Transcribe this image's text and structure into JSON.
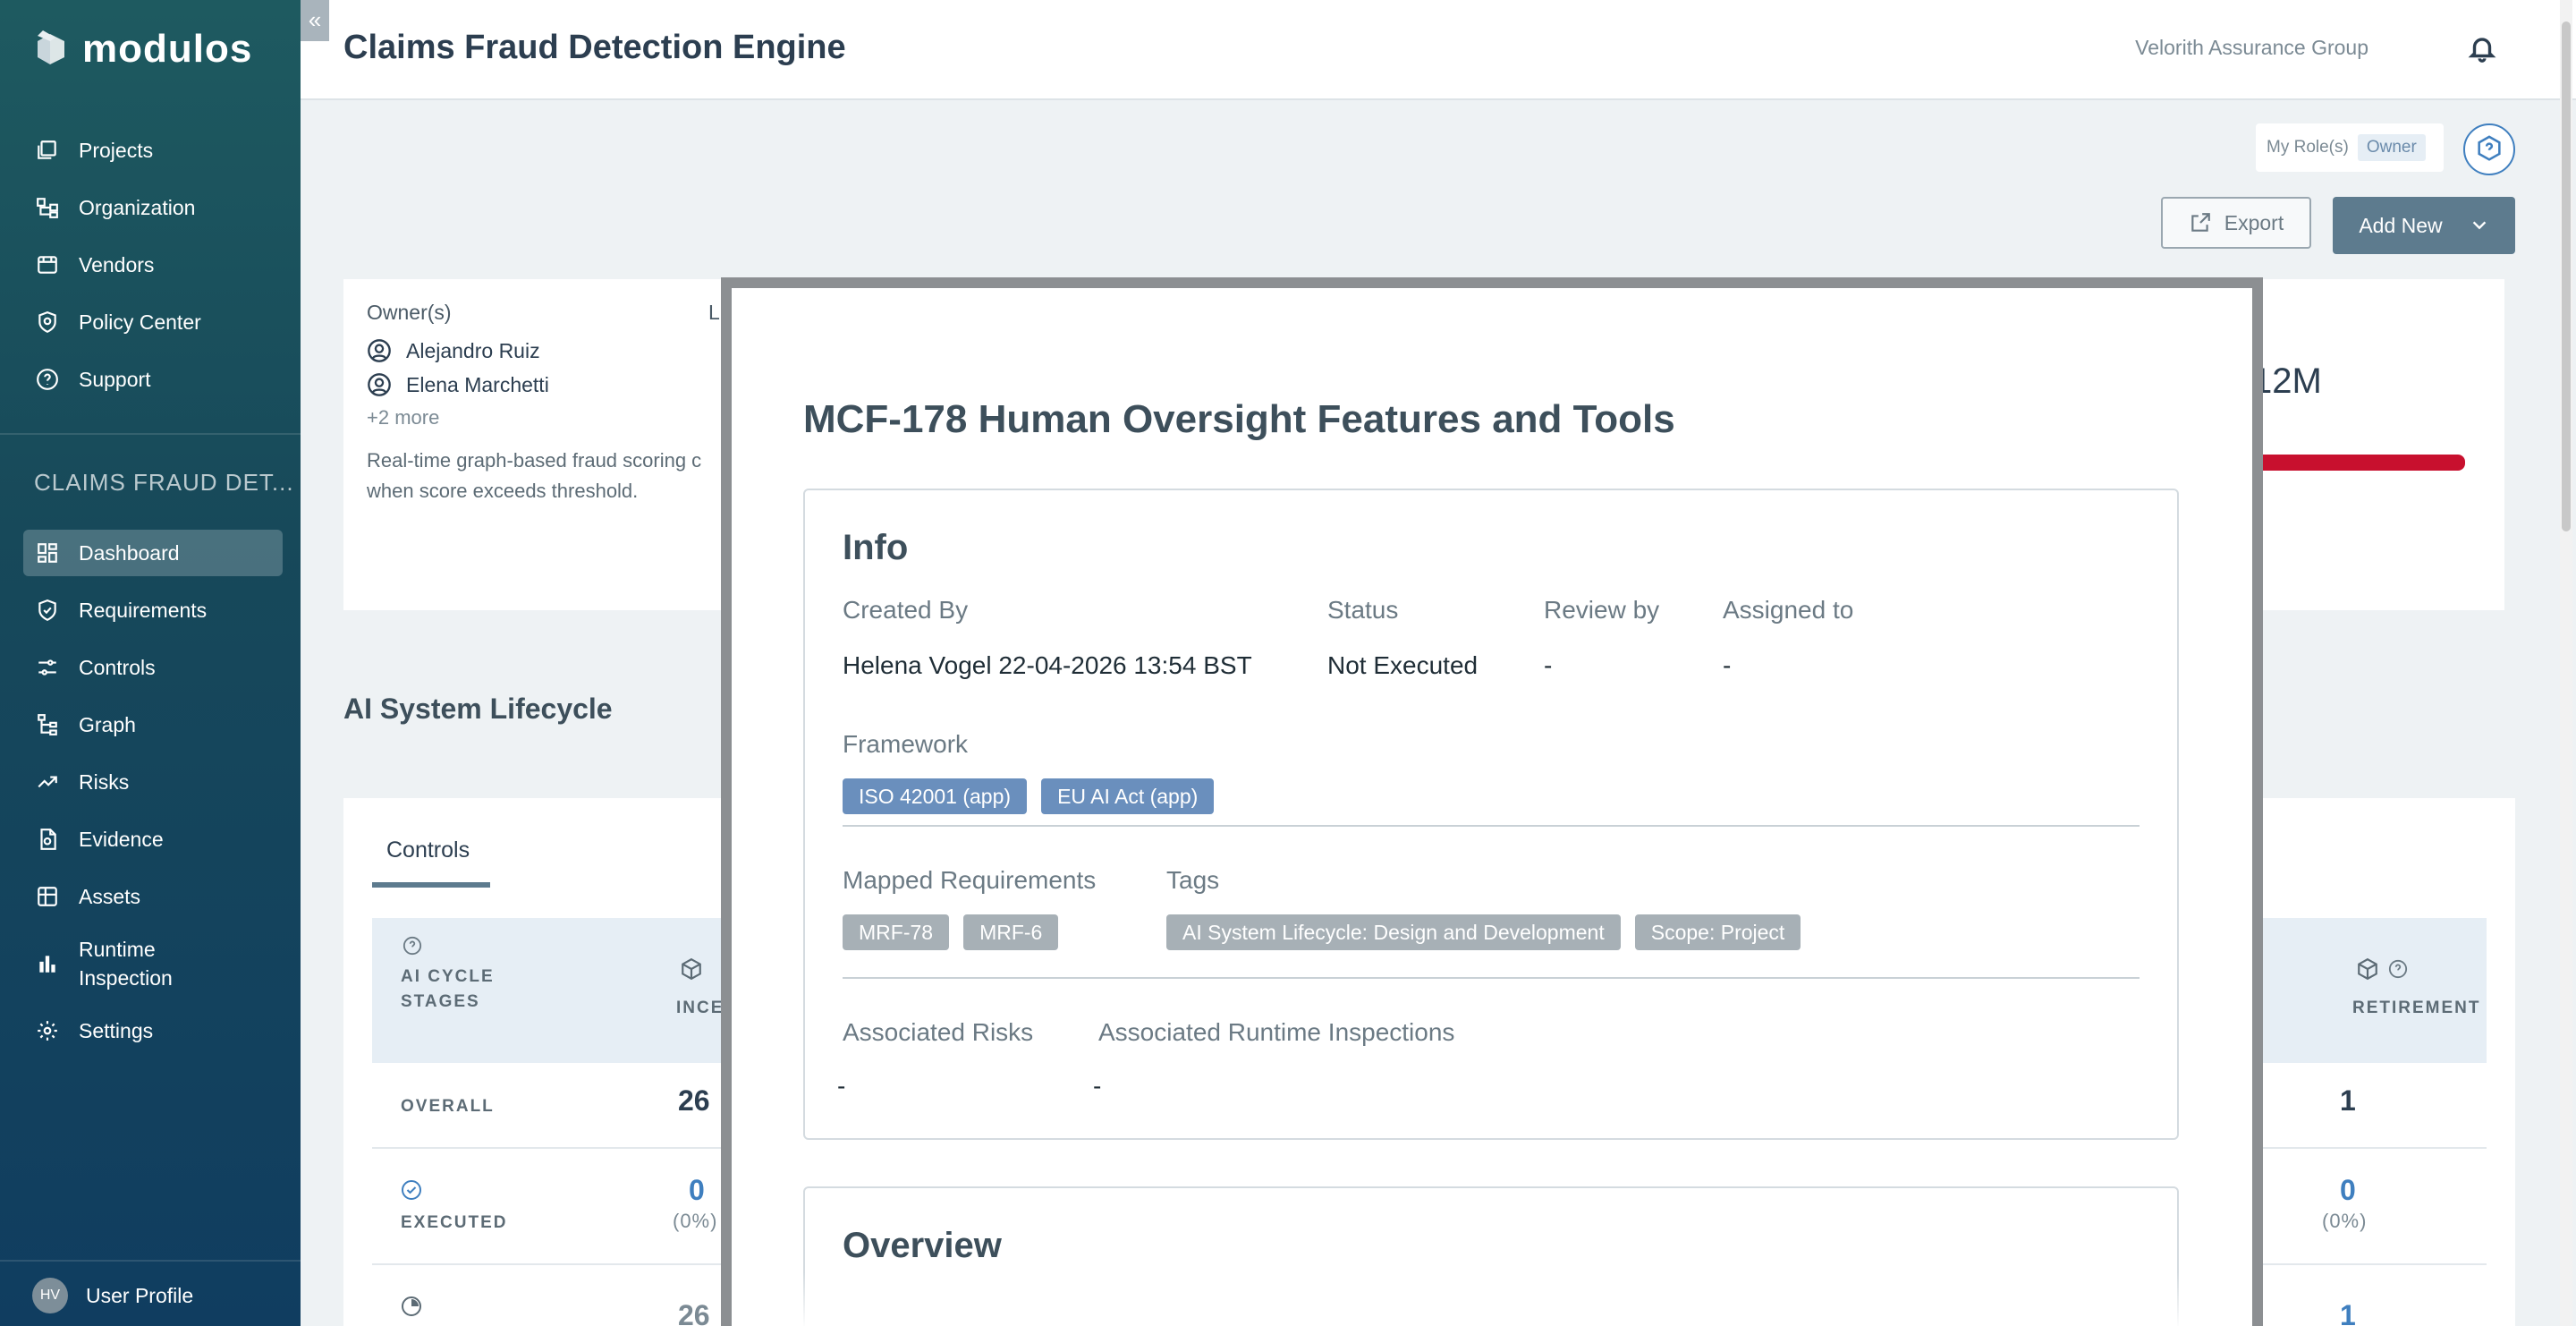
{
  "sidebar": {
    "logo": "modulos",
    "collapse_glyph": "«",
    "main_nav": [
      {
        "label": "Projects",
        "icon": "projects-icon"
      },
      {
        "label": "Organization",
        "icon": "organization-icon"
      },
      {
        "label": "Vendors",
        "icon": "vendors-icon"
      },
      {
        "label": "Policy Center",
        "icon": "policy-center-icon"
      },
      {
        "label": "Support",
        "icon": "support-icon"
      }
    ],
    "project_heading": "CLAIMS FRAUD DET...",
    "project_nav": [
      {
        "label": "Dashboard",
        "icon": "dashboard-icon",
        "active": true
      },
      {
        "label": "Requirements",
        "icon": "requirements-icon"
      },
      {
        "label": "Controls",
        "icon": "controls-icon"
      },
      {
        "label": "Graph",
        "icon": "graph-icon"
      },
      {
        "label": "Risks",
        "icon": "risks-icon"
      },
      {
        "label": "Evidence",
        "icon": "evidence-icon"
      },
      {
        "label": "Assets",
        "icon": "assets-icon"
      },
      {
        "label": "Runtime Inspection",
        "icon": "runtime-inspection-icon"
      },
      {
        "label": "Settings",
        "icon": "settings-icon"
      }
    ],
    "user": {
      "initials": "HV",
      "label": "User Profile"
    }
  },
  "header": {
    "title": "Claims Fraud Detection Engine",
    "org": "Velorith Assurance Group"
  },
  "toolbar": {
    "role_label": "My Role(s)",
    "role_value": "Owner",
    "export_label": "Export",
    "add_new_label": "Add New"
  },
  "owner_card": {
    "owners_label": "Owner(s)",
    "owners": [
      "Alejandro Ruiz",
      "Elena Marchetti"
    ],
    "more": "+2 more",
    "description_line1": "Real-time graph-based fraud scoring c",
    "description_line2": "when score exceeds threshold.",
    "stub_label": "L",
    "right_value": "12M"
  },
  "lifecycle": {
    "section_title": "AI System Lifecycle",
    "tab": "Controls",
    "stage_label": "AI CYCLE STAGES",
    "col_inception": "INCE",
    "col_retirement": "RETIREMENT",
    "rows": [
      {
        "label": "OVERALL",
        "inception": "26",
        "retirement": "1"
      },
      {
        "label": "EXECUTED",
        "inception": "0",
        "inception_pct": "(0%)",
        "retirement": "0",
        "retirement_pct": "(0%)"
      },
      {
        "label": "",
        "inception": "26",
        "retirement": "1"
      }
    ]
  },
  "modal": {
    "title": "MCF-178 Human Oversight Features and Tools",
    "info": {
      "title": "Info",
      "created_by_label": "Created By",
      "created_by_value": "Helena Vogel 22-04-2026 13:54 BST",
      "status_label": "Status",
      "status_value": "Not Executed",
      "review_label": "Review by",
      "review_value": "-",
      "assigned_label": "Assigned to",
      "assigned_value": "-",
      "framework_label": "Framework",
      "frameworks": [
        "ISO 42001 (app)",
        "EU AI Act (app)"
      ],
      "mapped_label": "Mapped Requirements",
      "mapped": [
        "MRF-78",
        "MRF-6"
      ],
      "tags_label": "Tags",
      "tags": [
        "AI System Lifecycle: Design and Development",
        "Scope: Project"
      ],
      "risks_label": "Associated Risks",
      "risks_value": "-",
      "inspections_label": "Associated Runtime Inspections",
      "inspections_value": "-"
    },
    "overview": {
      "title": "Overview"
    }
  },
  "colors": {
    "accent": "#5d7b8e",
    "framework_tag": "#6a8fbd",
    "neutral_tag": "#a7b0b6",
    "progress_red": "#c8102e",
    "link_blue": "#3f7fbf"
  }
}
